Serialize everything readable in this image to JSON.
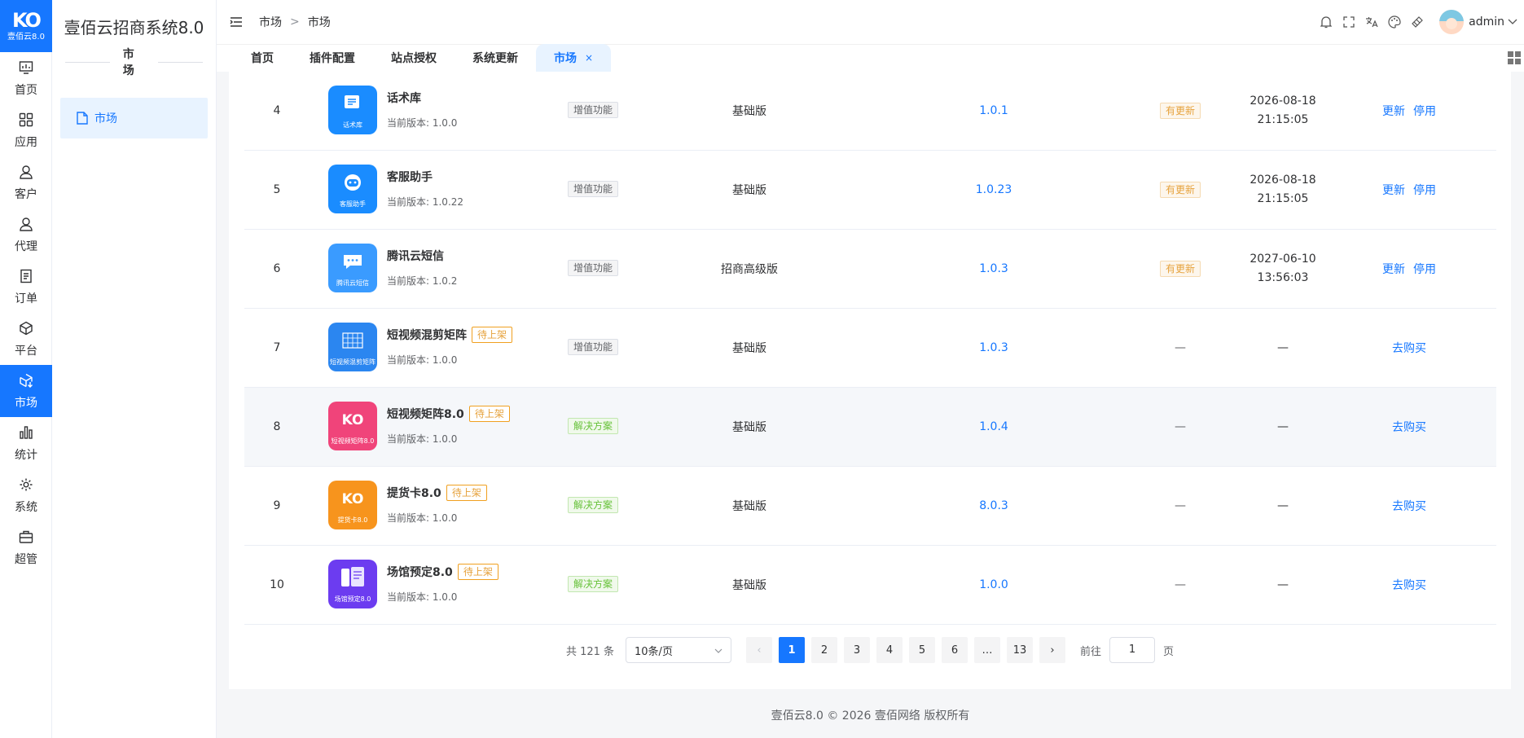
{
  "brand": {
    "mark": "KO",
    "version_badge": "壹佰云8.0",
    "system_title": "壹佰云招商系统8.0"
  },
  "rail": [
    {
      "label": "首页",
      "icon": "dashboard-icon"
    },
    {
      "label": "应用",
      "icon": "apps-icon"
    },
    {
      "label": "客户",
      "icon": "user-icon"
    },
    {
      "label": "代理",
      "icon": "agent-icon"
    },
    {
      "label": "订单",
      "icon": "order-icon"
    },
    {
      "label": "平台",
      "icon": "cube-icon"
    },
    {
      "label": "市场",
      "icon": "market-icon",
      "active": true
    },
    {
      "label": "统计",
      "icon": "stats-icon"
    },
    {
      "label": "系统",
      "icon": "gear-icon"
    },
    {
      "label": "超管",
      "icon": "briefcase-icon"
    }
  ],
  "side2": {
    "group": "市场",
    "item": "市场"
  },
  "breadcrumb": [
    "市场",
    "市场"
  ],
  "header": {
    "username": "admin"
  },
  "tabs": [
    {
      "label": "首页"
    },
    {
      "label": "插件配置"
    },
    {
      "label": "站点授权"
    },
    {
      "label": "系统更新"
    },
    {
      "label": "市场",
      "active": true,
      "close": "×"
    }
  ],
  "rows": [
    {
      "idx": "4",
      "name": "话术库",
      "cap": "话术库",
      "version_text": "当前版本: 1.0.0",
      "type": "增值功能",
      "edition": "基础版",
      "latest": "1.0.1",
      "status": "有更新",
      "date": "2026-08-18",
      "time": "21:15:05",
      "actions": [
        "更新",
        "停用"
      ],
      "color": "#1a8cff",
      "pending": ""
    },
    {
      "idx": "5",
      "name": "客服助手",
      "cap": "客服助手",
      "version_text": "当前版本: 1.0.22",
      "type": "增值功能",
      "edition": "基础版",
      "latest": "1.0.23",
      "status": "有更新",
      "date": "2026-08-18",
      "time": "21:15:05",
      "actions": [
        "更新",
        "停用"
      ],
      "color": "#1a8cff",
      "pending": ""
    },
    {
      "idx": "6",
      "name": "腾讯云短信",
      "cap": "腾讯云短信",
      "version_text": "当前版本: 1.0.2",
      "type": "增值功能",
      "edition": "招商高级版",
      "latest": "1.0.3",
      "status": "有更新",
      "date": "2027-06-10",
      "time": "13:56:03",
      "actions": [
        "更新",
        "停用"
      ],
      "color": "#3a9bff",
      "pending": ""
    },
    {
      "idx": "7",
      "name": "短视频混剪矩阵",
      "cap": "短视频混剪矩阵",
      "version_text": "当前版本: 1.0.0",
      "type": "增值功能",
      "edition": "基础版",
      "latest": "1.0.3",
      "status": "—",
      "date": "—",
      "time": "",
      "actions": [
        "去购买"
      ],
      "color": "#2b86f0",
      "pending": "待上架"
    },
    {
      "idx": "8",
      "name": "短视频矩阵8.0",
      "cap": "短视频矩阵8.0",
      "version_text": "当前版本: 1.0.0",
      "type": "解决方案",
      "edition": "基础版",
      "latest": "1.0.4",
      "status": "—",
      "date": "—",
      "time": "",
      "actions": [
        "去购买"
      ],
      "color": "#f0447a",
      "pending": "待上架"
    },
    {
      "idx": "9",
      "name": "提货卡8.0",
      "cap": "提货卡8.0",
      "version_text": "当前版本: 1.0.0",
      "type": "解决方案",
      "edition": "基础版",
      "latest": "8.0.3",
      "status": "—",
      "date": "—",
      "time": "",
      "actions": [
        "去购买"
      ],
      "color": "#f7941d",
      "pending": "待上架"
    },
    {
      "idx": "10",
      "name": "场馆预定8.0",
      "cap": "场馆预定8.0",
      "version_text": "当前版本: 1.0.0",
      "type": "解决方案",
      "edition": "基础版",
      "latest": "1.0.0",
      "status": "—",
      "date": "—",
      "time": "",
      "actions": [
        "去购买"
      ],
      "color": "#6c3cf0",
      "pending": "待上架"
    }
  ],
  "pager": {
    "total": "共 121 条",
    "size": "10条/页",
    "pages": [
      "1",
      "2",
      "3",
      "4",
      "5",
      "6",
      "…",
      "13"
    ],
    "prev": "‹",
    "next": "›",
    "goto": "前往",
    "goto_value": "1",
    "unit": "页"
  },
  "footer": "壹佰云8.0 © 2026 壹佰网络 版权所有"
}
